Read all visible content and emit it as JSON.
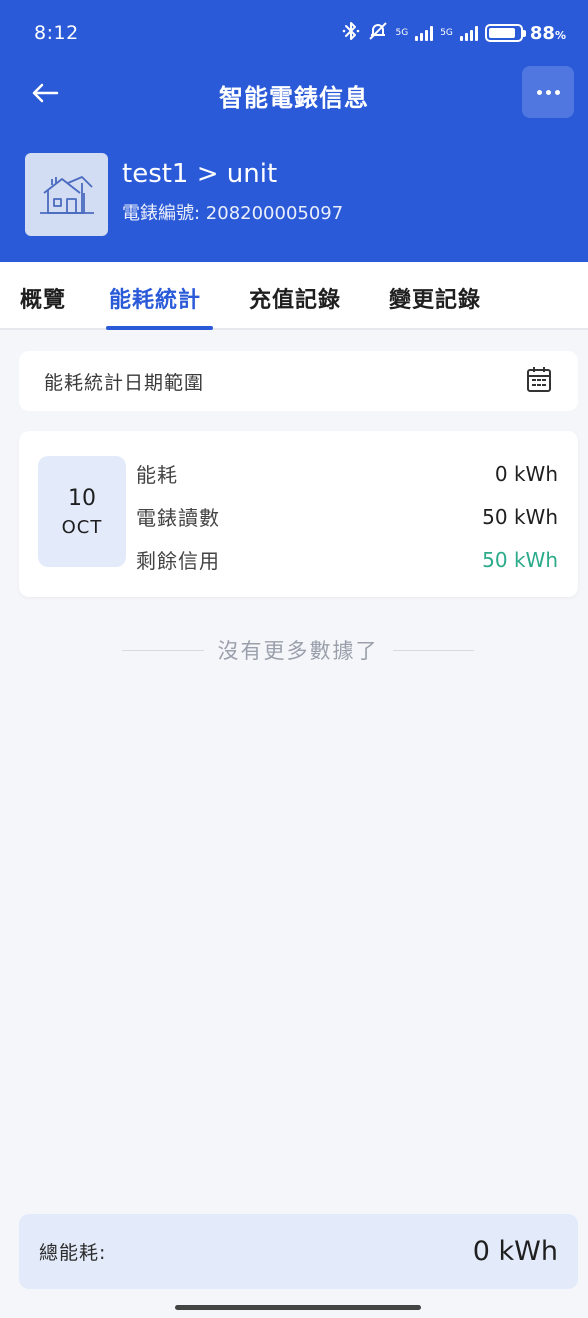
{
  "status_bar": {
    "time": "8:12",
    "network_1": "5G",
    "network_2": "5G",
    "battery": "88",
    "battery_unit": "%"
  },
  "nav": {
    "title": "智能電錶信息"
  },
  "meter": {
    "name": "test1 > unit",
    "number_label": "電錶編號: 208200005097"
  },
  "tabs": [
    {
      "label": "概覽",
      "active": false
    },
    {
      "label": "能耗統計",
      "active": true
    },
    {
      "label": "充值記錄",
      "active": false
    },
    {
      "label": "變更記錄",
      "active": false
    }
  ],
  "date_range": {
    "label": "能耗統計日期範圍",
    "icon": "calendar-icon"
  },
  "record": {
    "day": "10",
    "month": "OCT",
    "rows": [
      {
        "label": "能耗",
        "value": "0 kWh"
      },
      {
        "label": "電錶讀數",
        "value": "50 kWh"
      },
      {
        "label": "剩餘信用",
        "value": "50 kWh",
        "color": "#2bab8a"
      }
    ]
  },
  "no_more": "沒有更多數據了",
  "footer": {
    "label": "總能耗:",
    "value": "0 kWh"
  },
  "colors": {
    "primary": "#2a5ad8",
    "accent_green": "#2bab8a",
    "background": "#f5f6fa"
  }
}
